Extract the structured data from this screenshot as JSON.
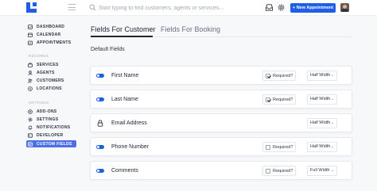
{
  "header": {
    "search_placeholder": "Start typing to find customers, agents or services...",
    "new_button": "+ New Appointment",
    "accent": "#1f5fe8"
  },
  "sidebar": {
    "main_items": [
      {
        "label": "DASHBOARD",
        "icon": "dashboard-icon"
      },
      {
        "label": "CALENDAR",
        "icon": "calendar-icon"
      },
      {
        "label": "APPOINTMENTS",
        "icon": "appointments-icon"
      }
    ],
    "records_heading": "RECORDS",
    "records_items": [
      {
        "label": "SERVICES",
        "icon": "services-icon"
      },
      {
        "label": "AGENTS",
        "icon": "agents-icon"
      },
      {
        "label": "CUSTOMERS",
        "icon": "customers-icon"
      },
      {
        "label": "LOCATIONS",
        "icon": "locations-icon"
      }
    ],
    "settings_heading": "SETTINGS",
    "settings_items": [
      {
        "label": "ADD-ONS",
        "icon": "addons-icon"
      },
      {
        "label": "SETTINGS",
        "icon": "settings-icon"
      },
      {
        "label": "NOTIFICATIONS",
        "icon": "notifications-icon"
      },
      {
        "label": "DEVELOPER",
        "icon": "developer-icon"
      },
      {
        "label": "CUSTOM FIELDS",
        "icon": "custom-fields-icon",
        "active": true
      }
    ]
  },
  "main": {
    "tabs": [
      {
        "label": "Fields For Customer",
        "active": true
      },
      {
        "label": "Fields For Booking",
        "active": false
      }
    ],
    "section_title": "Default Fields",
    "fields": [
      {
        "name": "First Name",
        "control": "toggle",
        "enabled": true,
        "required_label": "Required?",
        "required": true,
        "width": "Half Width"
      },
      {
        "name": "Last Name",
        "control": "toggle",
        "enabled": true,
        "required_label": "Required?",
        "required": true,
        "width": "Half Width"
      },
      {
        "name": "Email Address",
        "control": "lock",
        "width": "Half Width"
      },
      {
        "name": "Phone Number",
        "control": "toggle",
        "enabled": true,
        "required_label": "Required?",
        "required": false,
        "width": "Half Width"
      },
      {
        "name": "Comments",
        "control": "toggle",
        "enabled": true,
        "required_label": "Required?",
        "required": false,
        "width": "Full Width"
      }
    ]
  }
}
